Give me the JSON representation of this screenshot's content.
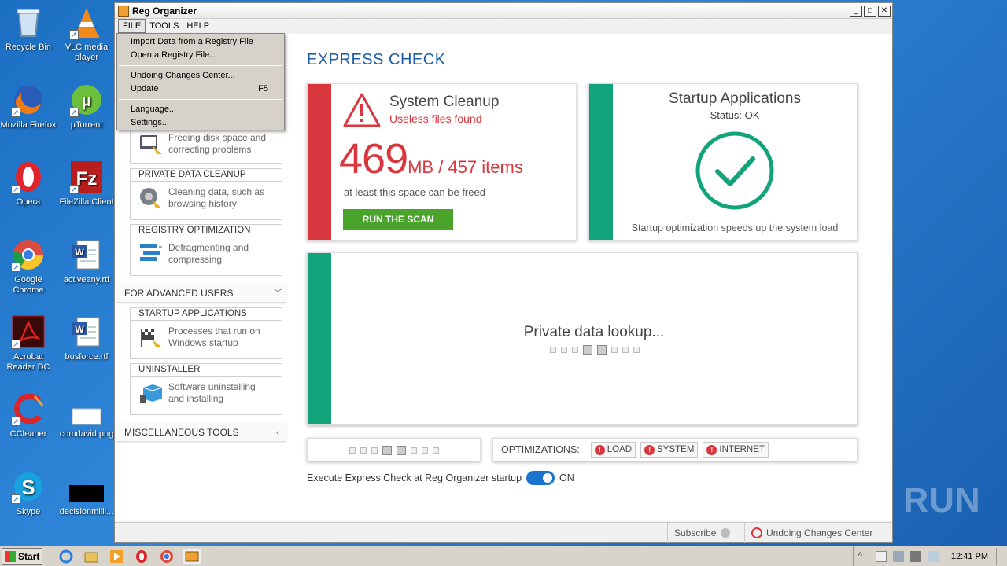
{
  "desktop": {
    "icons": [
      {
        "label": "Recycle Bin",
        "icon": "recycle-bin-icon"
      },
      {
        "label": "VLC media player",
        "icon": "vlc-icon"
      },
      {
        "label": "Mozilla Firefox",
        "icon": "firefox-icon"
      },
      {
        "label": "µTorrent",
        "icon": "utorrent-icon"
      },
      {
        "label": "Opera",
        "icon": "opera-icon"
      },
      {
        "label": "FileZilla Client",
        "icon": "filezilla-icon"
      },
      {
        "label": "Google Chrome",
        "icon": "chrome-icon"
      },
      {
        "label": "activeany.rtf",
        "icon": "word-doc-icon"
      },
      {
        "label": "Acrobat Reader DC",
        "icon": "acrobat-icon"
      },
      {
        "label": "busforce.rtf",
        "icon": "word-doc-icon"
      },
      {
        "label": "CCleaner",
        "icon": "ccleaner-icon"
      },
      {
        "label": "comdavid.png",
        "icon": "image-file-icon"
      },
      {
        "label": "Skype",
        "icon": "skype-icon"
      },
      {
        "label": "decisionmilli...",
        "icon": "black-file-icon"
      }
    ]
  },
  "window": {
    "title": "Reg Organizer",
    "menus": [
      "FILE",
      "TOOLS",
      "HELP"
    ]
  },
  "file_menu": {
    "items": [
      {
        "label": "Import Data from a Registry File",
        "shortcut": ""
      },
      {
        "label": "Open a Registry File...",
        "shortcut": ""
      },
      {
        "label": "Undoing Changes Center...",
        "shortcut": ""
      },
      {
        "label": "Update",
        "shortcut": "F5"
      },
      {
        "label": "Language...",
        "shortcut": ""
      },
      {
        "label": "Settings...",
        "shortcut": ""
      }
    ]
  },
  "leftnav": {
    "partial_card_text": "Freeing disk space and correcting problems",
    "cards": [
      {
        "header": "PRIVATE DATA CLEANUP",
        "text": "Cleaning data, such as browsing history",
        "icon": "privacy-cleanup-icon"
      },
      {
        "header": "REGISTRY OPTIMIZATION",
        "text": "Defragmenting and compressing",
        "icon": "registry-icon"
      },
      {
        "header": "STARTUP APPLICATIONS",
        "text": "Processes that run on Windows startup",
        "icon": "startup-flag-icon"
      },
      {
        "header": "UNINSTALLER",
        "text": "Software uninstalling and installing",
        "icon": "uninstaller-icon"
      }
    ],
    "section_advanced": "FOR ADVANCED USERS",
    "section_misc": "MISCELLANEOUS TOOLS"
  },
  "main": {
    "heading": "EXPRESS CHECK",
    "cleanup": {
      "title": "System Cleanup",
      "subtitle": "Useless files found",
      "size_number": "469",
      "size_suffix": "MB / 457 items",
      "note": "at least this space can be freed",
      "button": "RUN THE SCAN"
    },
    "startup": {
      "title": "Startup Applications",
      "status": "Status: OK",
      "note": "Startup optimization speeds up the system load"
    },
    "private_lookup": "Private data lookup...",
    "optimizations": {
      "label": "OPTIMIZATIONS:",
      "buttons": [
        "LOAD",
        "SYSTEM",
        "INTERNET"
      ]
    },
    "startup_toggle_label": "Execute Express Check at Reg Organizer startup",
    "startup_toggle_state": "ON"
  },
  "statusbar": {
    "subscribe": "Subscribe",
    "undo_center": "Undoing Changes Center"
  },
  "taskbar": {
    "start": "Start",
    "time": "12:41 PM"
  },
  "watermark": "ANY RUN",
  "colors": {
    "accent_blue": "#1e5ea8",
    "alert_red": "#d9363e",
    "ok_green": "#12a37a",
    "scan_green": "#4aa32b"
  }
}
